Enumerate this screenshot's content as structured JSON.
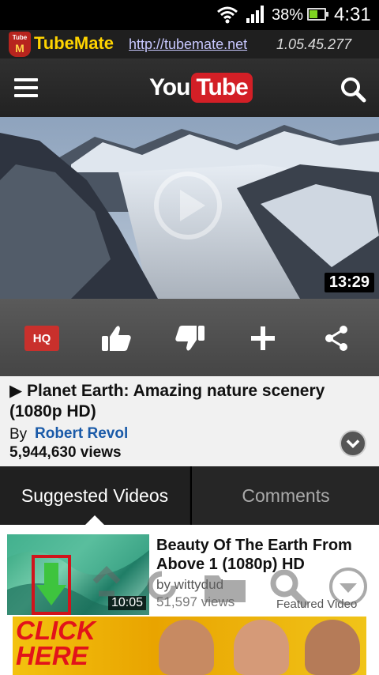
{
  "status_bar": {
    "battery_percent": "38%",
    "time": "4:31",
    "icons": [
      "wifi-icon",
      "signal-icon",
      "battery-icon"
    ]
  },
  "tubemate_bar": {
    "logo_top": "Tube",
    "logo_bottom": "M",
    "app_name": "TubeMate",
    "url": "http://tubemate.net",
    "version": "1.05.45.277"
  },
  "youtube_bar": {
    "logo_you": "You",
    "logo_tube": "Tube",
    "icons": [
      "menu-icon",
      "search-icon"
    ]
  },
  "player": {
    "duration": "13:29"
  },
  "actions": {
    "hq_label": "HQ",
    "icons": [
      "thumbs-up-icon",
      "thumbs-down-icon",
      "plus-icon",
      "share-icon"
    ]
  },
  "video_info": {
    "title": "▶ Planet Earth: Amazing nature scenery (1080p HD)",
    "by_label": "By",
    "author": "Robert Revol",
    "views": "5,944,630 views"
  },
  "tabs": [
    {
      "label": "Suggested Videos",
      "active": true
    },
    {
      "label": "Comments",
      "active": false
    }
  ],
  "suggested": [
    {
      "title": "Beauty Of The Earth From Above 1 (1080p) HD",
      "by": "by wittydud",
      "views": "51,597 views",
      "duration": "10:05",
      "tag": "Featured Video"
    }
  ],
  "ad": {
    "text_line1": "CLICK",
    "text_line2": "HERE"
  },
  "colors": {
    "tubemate_yellow": "#ffd400",
    "youtube_red": "#d31f26",
    "link_blue": "#1a5aa8",
    "hq_red": "#c9302c"
  }
}
